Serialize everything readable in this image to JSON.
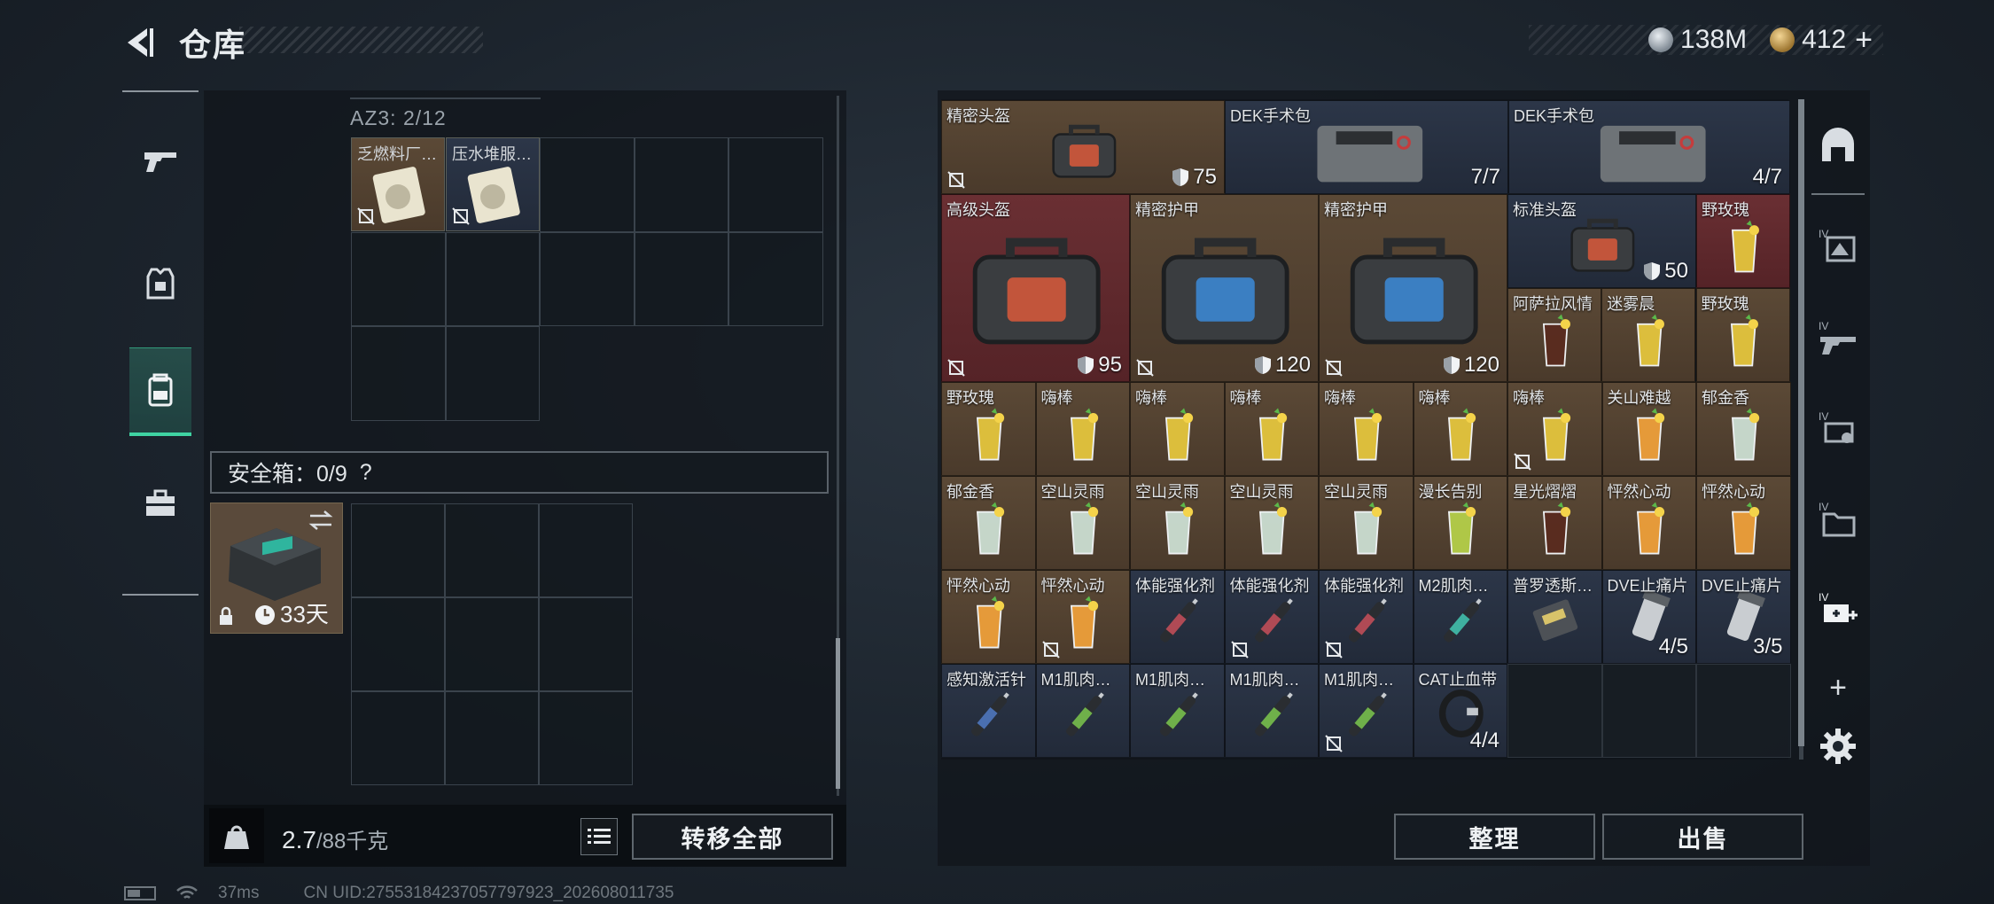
{
  "header": {
    "title": "仓库",
    "currency_silver": "138M",
    "currency_gold": "412",
    "currency_gold_plus": "+"
  },
  "left_nav": {
    "items": [
      {
        "key": "weapons",
        "icon": "pistol-icon"
      },
      {
        "key": "equipment",
        "icon": "armor-icon"
      },
      {
        "key": "backpack",
        "icon": "backpack-icon"
      },
      {
        "key": "case",
        "icon": "briefcase-icon"
      }
    ],
    "active": "backpack"
  },
  "left_panel": {
    "container_label": "AZ3: 2/12",
    "container_items": [
      {
        "name": "乏燃料厂…",
        "bound": true
      },
      {
        "name": "压水堆服…",
        "bound": true
      }
    ],
    "safe_label": "安全箱：0/9",
    "safe_help": "?",
    "safebox_time": "33天",
    "weight_current": "2.7",
    "weight_max": "/88千克",
    "transfer_all": "转移全部"
  },
  "stash": {
    "row1": [
      {
        "name": "精密头盔",
        "value": "75",
        "shield": true,
        "bound": true,
        "color": "brown"
      },
      {
        "name": "DEK手术包",
        "value": "7/7",
        "color": "navy"
      },
      {
        "name": "DEK手术包",
        "value": "4/7",
        "color": "navy"
      }
    ],
    "row2_large": [
      {
        "name": "高级头盔",
        "value": "95",
        "shield": true,
        "bound": true,
        "color": "red"
      },
      {
        "name": "精密护甲",
        "value": "120",
        "shield": true,
        "bound": true,
        "color": "brown"
      },
      {
        "name": "精密护甲",
        "value": "120",
        "shield": true,
        "bound": true,
        "color": "brown"
      }
    ],
    "row2_small": [
      {
        "name": "标准头盔",
        "value": "50",
        "shield": true,
        "color": "navy"
      },
      {
        "name": "野玫瑰",
        "color": "red"
      },
      {
        "name": "阿萨拉风情",
        "color": "brown"
      },
      {
        "name": "迷雾晨",
        "color": "brown"
      },
      {
        "name": "野玫瑰",
        "color": "brown"
      }
    ],
    "row3": [
      {
        "name": "野玫瑰",
        "color": "brown"
      },
      {
        "name": "嗨棒",
        "color": "brown"
      },
      {
        "name": "嗨棒",
        "color": "brown"
      },
      {
        "name": "嗨棒",
        "color": "brown"
      },
      {
        "name": "嗨棒",
        "color": "brown"
      },
      {
        "name": "嗨棒",
        "color": "brown"
      },
      {
        "name": "嗨棒",
        "bound": true,
        "color": "brown"
      },
      {
        "name": "关山难越",
        "color": "brown"
      },
      {
        "name": "郁金香",
        "color": "brown"
      }
    ],
    "row4": [
      {
        "name": "郁金香",
        "color": "brown"
      },
      {
        "name": "空山灵雨",
        "color": "brown"
      },
      {
        "name": "空山灵雨",
        "color": "brown"
      },
      {
        "name": "空山灵雨",
        "color": "brown"
      },
      {
        "name": "空山灵雨",
        "color": "brown"
      },
      {
        "name": "漫长告别",
        "color": "brown"
      },
      {
        "name": "星光熠熠",
        "color": "brown"
      },
      {
        "name": "怦然心动",
        "color": "brown"
      },
      {
        "name": "怦然心动",
        "color": "brown"
      }
    ],
    "row5": [
      {
        "name": "怦然心动",
        "color": "brown"
      },
      {
        "name": "怦然心动",
        "bound": true,
        "color": "brown"
      },
      {
        "name": "体能强化剂",
        "color": "navy"
      },
      {
        "name": "体能强化剂",
        "bound": true,
        "color": "navy"
      },
      {
        "name": "体能强化剂",
        "bound": true,
        "color": "navy"
      },
      {
        "name": "M2肌肉…",
        "color": "navy"
      },
      {
        "name": "普罗透斯…",
        "color": "navy"
      },
      {
        "name": "DVE止痛片",
        "value": "4/5",
        "color": "navy"
      },
      {
        "name": "DVE止痛片",
        "value": "3/5",
        "color": "navy"
      }
    ],
    "row6": [
      {
        "name": "感知激活针",
        "color": "navy"
      },
      {
        "name": "M1肌肉…",
        "color": "navy"
      },
      {
        "name": "M1肌肉…",
        "color": "navy"
      },
      {
        "name": "M1肌肉…",
        "color": "navy"
      },
      {
        "name": "M1肌肉…",
        "bound": true,
        "color": "navy"
      },
      {
        "name": "CAT止血带",
        "value": "4/4",
        "color": "navy"
      }
    ]
  },
  "actions": {
    "sort": "整理",
    "sell": "出售"
  },
  "right_nav": {
    "plus": "+"
  },
  "footer": {
    "ping": "37ms",
    "uid": "CN UID:27553184237057797923_202608011735"
  },
  "colors": {
    "accent": "#3fd3a2",
    "brown": "#5b4936",
    "red": "#6a2f33",
    "navy": "#2c3648"
  }
}
